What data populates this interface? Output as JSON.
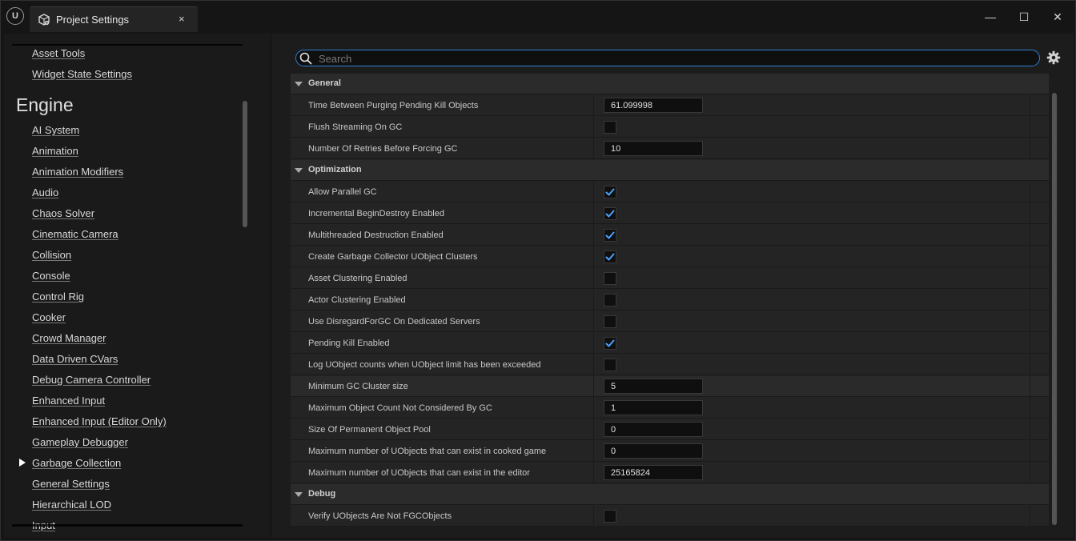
{
  "window": {
    "tab_title": "Project Settings",
    "tab_close": "×",
    "minimize": "—",
    "maximize": "☐",
    "close": "✕",
    "logo": "U",
    "accent_color": "#2d7fd1",
    "check_color": "#4aa3ff"
  },
  "sidebar": {
    "items_top": [
      {
        "label": "Asset Tools"
      },
      {
        "label": "Widget State Settings"
      }
    ],
    "section_heading": "Engine",
    "engine_items": [
      {
        "label": "AI System"
      },
      {
        "label": "Animation"
      },
      {
        "label": "Animation Modifiers"
      },
      {
        "label": "Audio"
      },
      {
        "label": "Chaos Solver"
      },
      {
        "label": "Cinematic Camera"
      },
      {
        "label": "Collision"
      },
      {
        "label": "Console"
      },
      {
        "label": "Control Rig"
      },
      {
        "label": "Cooker"
      },
      {
        "label": "Crowd Manager"
      },
      {
        "label": "Data Driven CVars"
      },
      {
        "label": "Debug Camera Controller"
      },
      {
        "label": "Enhanced Input"
      },
      {
        "label": "Enhanced Input (Editor Only)"
      },
      {
        "label": "Gameplay Debugger"
      },
      {
        "label": "Garbage Collection",
        "selected": true
      },
      {
        "label": "General Settings"
      },
      {
        "label": "Hierarchical LOD"
      },
      {
        "label": "Input"
      }
    ]
  },
  "search": {
    "placeholder": "Search",
    "value": ""
  },
  "details": {
    "categories": [
      {
        "name": "General",
        "properties": [
          {
            "label": "Time Between Purging Pending Kill Objects",
            "type": "number",
            "value": "61.099998"
          },
          {
            "label": "Flush Streaming On GC",
            "type": "checkbox",
            "checked": false
          },
          {
            "label": "Number Of Retries Before Forcing GC",
            "type": "number",
            "value": "10"
          }
        ]
      },
      {
        "name": "Optimization",
        "properties": [
          {
            "label": "Allow Parallel GC",
            "type": "checkbox",
            "checked": true
          },
          {
            "label": "Incremental BeginDestroy Enabled",
            "type": "checkbox",
            "checked": true
          },
          {
            "label": "Multithreaded Destruction Enabled",
            "type": "checkbox",
            "checked": true
          },
          {
            "label": "Create Garbage Collector UObject Clusters",
            "type": "checkbox",
            "checked": true
          },
          {
            "label": "Asset Clustering Enabled",
            "type": "checkbox",
            "checked": false
          },
          {
            "label": "Actor Clustering Enabled",
            "type": "checkbox",
            "checked": false
          },
          {
            "label": "Use DisregardForGC On Dedicated Servers",
            "type": "checkbox",
            "checked": false
          },
          {
            "label": "Pending Kill Enabled",
            "type": "checkbox",
            "checked": true
          },
          {
            "label": "Log UObject counts when UObject limit has been exceeded",
            "type": "checkbox",
            "checked": false
          },
          {
            "label": "Minimum GC Cluster size",
            "type": "number",
            "value": "5",
            "highlight": true
          },
          {
            "label": "Maximum Object Count Not Considered By GC",
            "type": "number",
            "value": "1"
          },
          {
            "label": "Size Of Permanent Object Pool",
            "type": "number",
            "value": "0"
          },
          {
            "label": "Maximum number of UObjects that can exist in cooked game",
            "type": "number",
            "value": "0"
          },
          {
            "label": "Maximum number of UObjects that can exist in the editor",
            "type": "number",
            "value": "25165824"
          }
        ]
      },
      {
        "name": "Debug",
        "properties": [
          {
            "label": "Verify UObjects Are Not FGCObjects",
            "type": "checkbox",
            "checked": false
          }
        ]
      }
    ]
  }
}
